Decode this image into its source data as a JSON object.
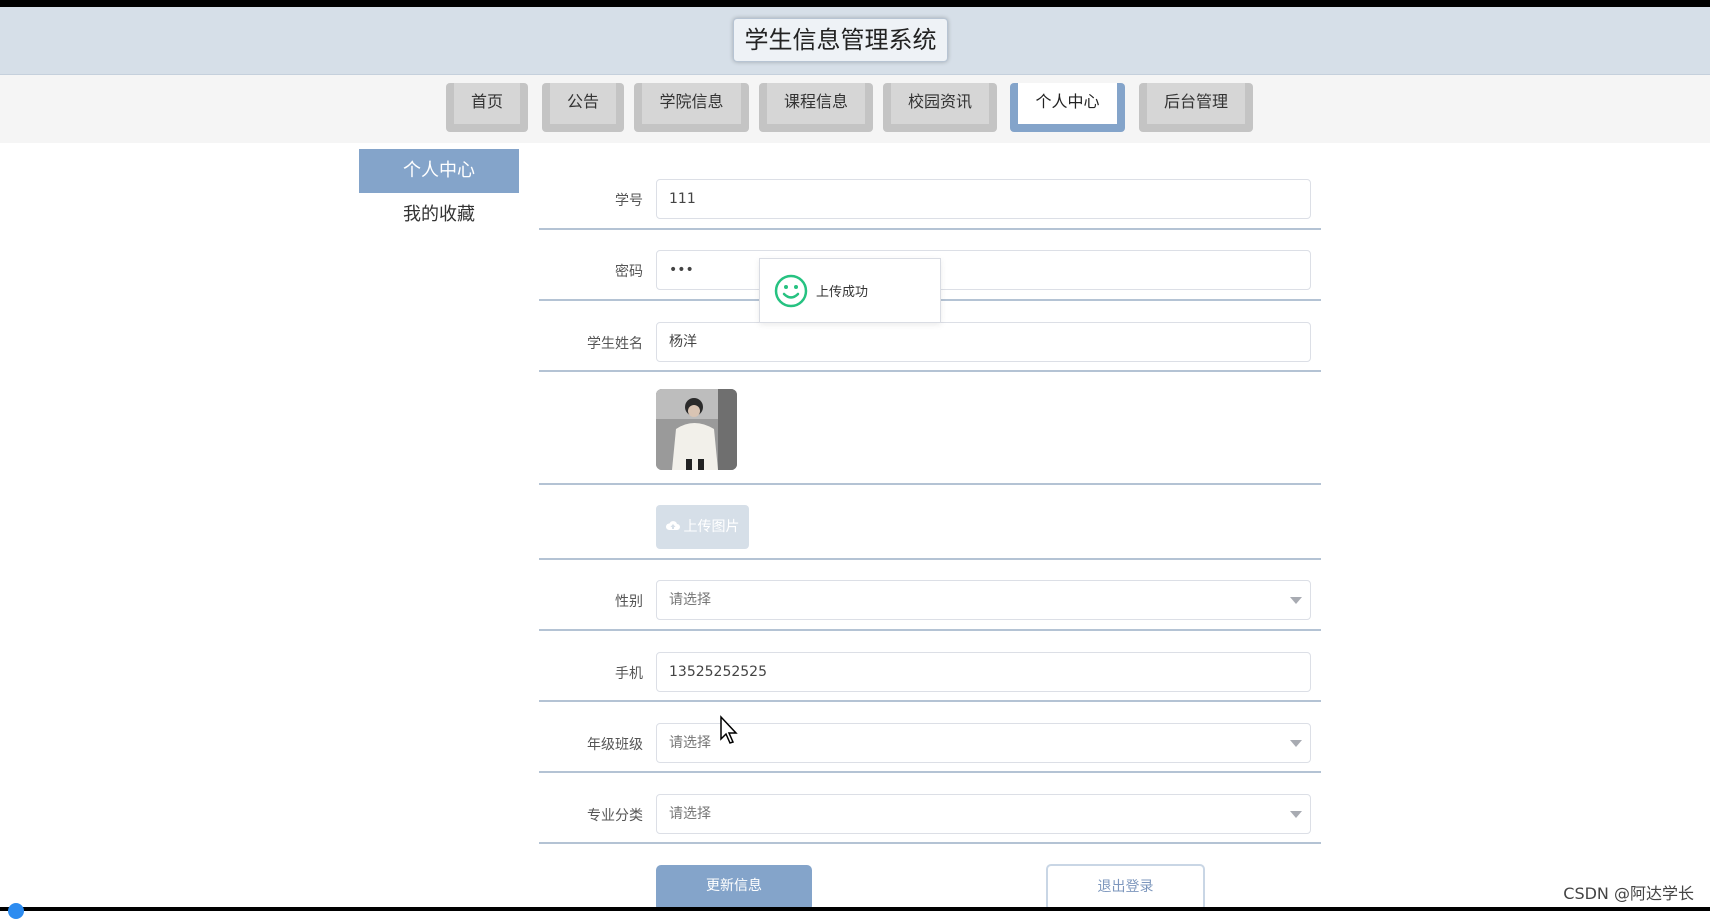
{
  "header": {
    "title": "学生信息管理系统"
  },
  "nav": {
    "items": [
      {
        "label": "首页"
      },
      {
        "label": "公告"
      },
      {
        "label": "学院信息"
      },
      {
        "label": "课程信息"
      },
      {
        "label": "校园资讯"
      },
      {
        "label": "个人中心",
        "active": true
      },
      {
        "label": "后台管理"
      }
    ]
  },
  "sidebar": {
    "items": [
      {
        "label": "个人中心",
        "active": true
      },
      {
        "label": "我的收藏"
      }
    ]
  },
  "form": {
    "student_id": {
      "label": "学号",
      "value": "111"
    },
    "password": {
      "label": "密码",
      "value": "•••"
    },
    "student_name": {
      "label": "学生姓名",
      "value": "杨洋"
    },
    "upload": {
      "label": "上传图片",
      "icon": "cloud-upload-icon"
    },
    "gender": {
      "label": "性别",
      "placeholder": "请选择"
    },
    "phone": {
      "label": "手机",
      "value": "13525252525"
    },
    "grade_class": {
      "label": "年级班级",
      "placeholder": "请选择"
    },
    "major": {
      "label": "专业分类",
      "placeholder": "请选择"
    }
  },
  "toast": {
    "message": "上传成功",
    "icon": "smile-icon",
    "color": "#26c281"
  },
  "actions": {
    "update": "更新信息",
    "logout": "退出登录"
  },
  "watermark": "CSDN @阿达学长",
  "colors": {
    "accent": "#84a4ca",
    "header_bg": "#d6dfe8",
    "nav_inactive": "#c4c4c4"
  }
}
